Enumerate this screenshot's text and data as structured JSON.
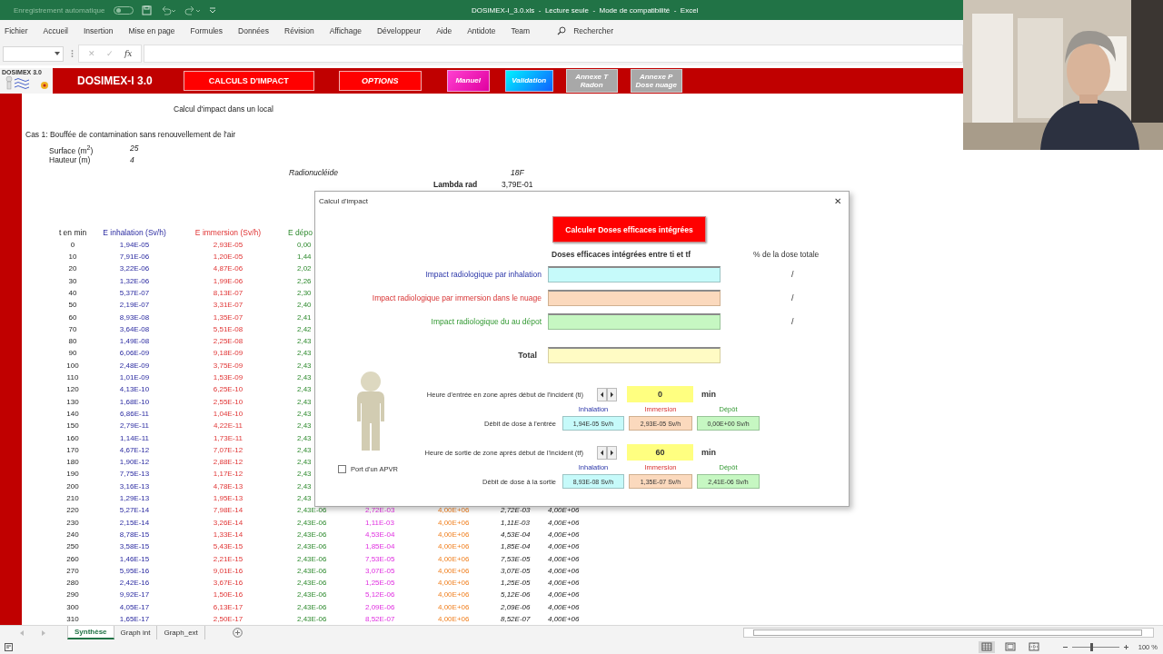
{
  "titlebar": {
    "autosave_label": "Enregistrement automatique",
    "autosave_on": false,
    "title": "DOSIMEX-I_3.0.xls  -  Lecture seule  -  Mode de compatibilité  -  Excel"
  },
  "menu": [
    {
      "label": "Fichier"
    },
    {
      "label": "Accueil"
    },
    {
      "label": "Insertion"
    },
    {
      "label": "Mise en page"
    },
    {
      "label": "Formules"
    },
    {
      "label": "Données"
    },
    {
      "label": "Révision"
    },
    {
      "label": "Affichage"
    },
    {
      "label": "Développeur"
    },
    {
      "label": "Aide"
    },
    {
      "label": "Antidote"
    },
    {
      "label": "Team"
    }
  ],
  "search_label": "Rechercher",
  "formula_bar": {
    "buttons": [
      {
        "label": "✕",
        "kind": "cancel",
        "disabled": true
      },
      {
        "label": "✓",
        "kind": "enter",
        "disabled": true
      },
      {
        "label": "fx",
        "kind": "function",
        "disabled": false
      }
    ]
  },
  "banner": {
    "logo_text": "DOSIMEX 3.0",
    "title": "DOSIMEX-I 3.0",
    "buttons": [
      {
        "lines": [
          "CALCULS D'IMPACT"
        ],
        "kind": "red"
      },
      {
        "lines": [
          "OPTIONS"
        ],
        "kind": "red-italic"
      },
      {
        "lines": [
          "Manuel"
        ],
        "kind": "magenta"
      },
      {
        "lines": [
          "Validation"
        ],
        "kind": "cyan"
      },
      {
        "lines": [
          "Annexe T",
          "Radon"
        ],
        "kind": "gray"
      },
      {
        "lines": [
          "Annexe P",
          "Dose nuage"
        ],
        "kind": "gray"
      }
    ]
  },
  "sheet": {
    "title": "Calcul d'impact dans un local",
    "case": "Cas 1: Bouffée de contamination sans renouvellement de l'air",
    "params": [
      {
        "label": "Surface (m$^{2}$)",
        "value": "25"
      },
      {
        "label": "Hauteur (m)",
        "value": "4"
      }
    ],
    "radionuclide": {
      "label": "Radionucléide",
      "value": "18F"
    },
    "lambda": {
      "label": "Lambda rad",
      "value": "3,79E-01"
    },
    "columns": [
      "t en min",
      "E inhalation (Sv/h)",
      "E immersion (Sv/h)",
      "E dépo"
    ],
    "rows": [
      [
        "0",
        "1,94E-05",
        "2,93E-05",
        "0,00"
      ],
      [
        "10",
        "7,91E-06",
        "1,20E-05",
        "1,44"
      ],
      [
        "20",
        "3,22E-06",
        "4,87E-06",
        "2,02"
      ],
      [
        "30",
        "1,32E-06",
        "1,99E-06",
        "2,26"
      ],
      [
        "40",
        "5,37E-07",
        "8,13E-07",
        "2,30"
      ],
      [
        "50",
        "2,19E-07",
        "3,31E-07",
        "2,40"
      ],
      [
        "60",
        "8,93E-08",
        "1,35E-07",
        "2,41"
      ],
      [
        "70",
        "3,64E-08",
        "5,51E-08",
        "2,42"
      ],
      [
        "80",
        "1,49E-08",
        "2,25E-08",
        "2,43"
      ],
      [
        "90",
        "6,06E-09",
        "9,18E-09",
        "2,43"
      ],
      [
        "100",
        "2,48E-09",
        "3,75E-09",
        "2,43"
      ],
      [
        "110",
        "1,01E-09",
        "1,53E-09",
        "2,43"
      ],
      [
        "120",
        "4,13E-10",
        "6,25E-10",
        "2,43"
      ],
      [
        "130",
        "1,68E-10",
        "2,55E-10",
        "2,43"
      ],
      [
        "140",
        "6,86E-11",
        "1,04E-10",
        "2,43"
      ],
      [
        "150",
        "2,79E-11",
        "4,22E-11",
        "2,43"
      ],
      [
        "160",
        "1,14E-11",
        "1,73E-11",
        "2,43"
      ],
      [
        "170",
        "4,67E-12",
        "7,07E-12",
        "2,43"
      ],
      [
        "180",
        "1,90E-12",
        "2,88E-12",
        "2,43"
      ],
      [
        "190",
        "7,75E-13",
        "1,17E-12",
        "2,43"
      ],
      [
        "200",
        "3,16E-13",
        "4,78E-13",
        "2,43"
      ],
      [
        "210",
        "1,29E-13",
        "1,95E-13",
        "2,43"
      ],
      [
        "220",
        "5,27E-14",
        "7,98E-14",
        "2,43E-06",
        "2,72E-03",
        "4,00E+06",
        "2,72E-03",
        "4,00E+06"
      ],
      [
        "230",
        "2,15E-14",
        "3,26E-14",
        "2,43E-06",
        "1,11E-03",
        "4,00E+06",
        "1,11E-03",
        "4,00E+06"
      ],
      [
        "240",
        "8,78E-15",
        "1,33E-14",
        "2,43E-06",
        "4,53E-04",
        "4,00E+06",
        "4,53E-04",
        "4,00E+06"
      ],
      [
        "250",
        "3,58E-15",
        "5,43E-15",
        "2,43E-06",
        "1,85E-04",
        "4,00E+06",
        "1,85E-04",
        "4,00E+06"
      ],
      [
        "260",
        "1,46E-15",
        "2,21E-15",
        "2,43E-06",
        "7,53E-05",
        "4,00E+06",
        "7,53E-05",
        "4,00E+06"
      ],
      [
        "270",
        "5,95E-16",
        "9,01E-16",
        "2,43E-06",
        "3,07E-05",
        "4,00E+06",
        "3,07E-05",
        "4,00E+06"
      ],
      [
        "280",
        "2,42E-16",
        "3,67E-16",
        "2,43E-06",
        "1,25E-05",
        "4,00E+06",
        "1,25E-05",
        "4,00E+06"
      ],
      [
        "290",
        "9,92E-17",
        "1,50E-16",
        "2,43E-06",
        "5,12E-06",
        "4,00E+06",
        "5,12E-06",
        "4,00E+06"
      ],
      [
        "300",
        "4,05E-17",
        "6,13E-17",
        "2,43E-06",
        "2,09E-06",
        "4,00E+06",
        "2,09E-06",
        "4,00E+06"
      ],
      [
        "310",
        "1,65E-17",
        "2,50E-17",
        "2,43E-06",
        "8,52E-07",
        "4,00E+06",
        "8,52E-07",
        "4,00E+06"
      ]
    ]
  },
  "dialog": {
    "title": "Calcul d'impact",
    "close": "✕",
    "calc_button": "Calculer Doses efficaces intégrées",
    "col_header": "Doses efficaces intégrées entre ti et tf",
    "pct_header": "% de la dose totale",
    "impacts": [
      {
        "label": "Impact radiologique par inhalation",
        "kind": "inhalation",
        "pct": "/"
      },
      {
        "label": "Impact radiologique par immersion dans le nuage",
        "kind": "immersion",
        "pct": "/"
      },
      {
        "label": "Impact radiologique du au dépot",
        "kind": "depot",
        "pct": "/"
      }
    ],
    "total_label": "Total",
    "apvr": {
      "label": "Port d'un APVR",
      "checked": false
    },
    "periods": [
      {
        "label": "Heure d'entrée en zone après début de l'incident (ti)",
        "value": "0",
        "unit": "min",
        "rate_label": "Débit de dose à l'entrée",
        "subheaders": [
          {
            "label": "Inhalation",
            "kind": "inhalation"
          },
          {
            "label": "Immersion",
            "kind": "immersion"
          },
          {
            "label": "Dépôt",
            "kind": "depot"
          }
        ],
        "rates": [
          {
            "value": "1,94E-05 Sv/h",
            "kind": "inhalation"
          },
          {
            "value": "2,93E-05 Sv/h",
            "kind": "immersion"
          },
          {
            "value": "0,00E+00 Sv/h",
            "kind": "depot"
          }
        ]
      },
      {
        "label": "Heure de sortie de zone après début de l'incident (tf)",
        "value": "60",
        "unit": "min",
        "rate_label": "Débit de dose à la sortie",
        "subheaders": [
          {
            "label": "Inhalation",
            "kind": "inhalation"
          },
          {
            "label": "Immersion",
            "kind": "immersion"
          },
          {
            "label": "Dépôt",
            "kind": "depot"
          }
        ],
        "rates": [
          {
            "value": "8,93E-08 Sv/h",
            "kind": "inhalation"
          },
          {
            "value": "1,35E-07 Sv/h",
            "kind": "immersion"
          },
          {
            "value": "2,41E-06 Sv/h",
            "kind": "depot"
          }
        ]
      }
    ]
  },
  "sheet_tabs": [
    {
      "label": "Synthèse",
      "selected": true
    },
    {
      "label": "Graph int",
      "selected": false
    },
    {
      "label": "Graph_ext",
      "selected": false
    }
  ],
  "status": {
    "views": [
      {
        "kind": "normal",
        "selected": true
      },
      {
        "kind": "page-layout",
        "selected": false
      },
      {
        "kind": "page-break",
        "selected": false
      }
    ],
    "zoom": {
      "level": 0.4,
      "reading": "100 %"
    }
  }
}
